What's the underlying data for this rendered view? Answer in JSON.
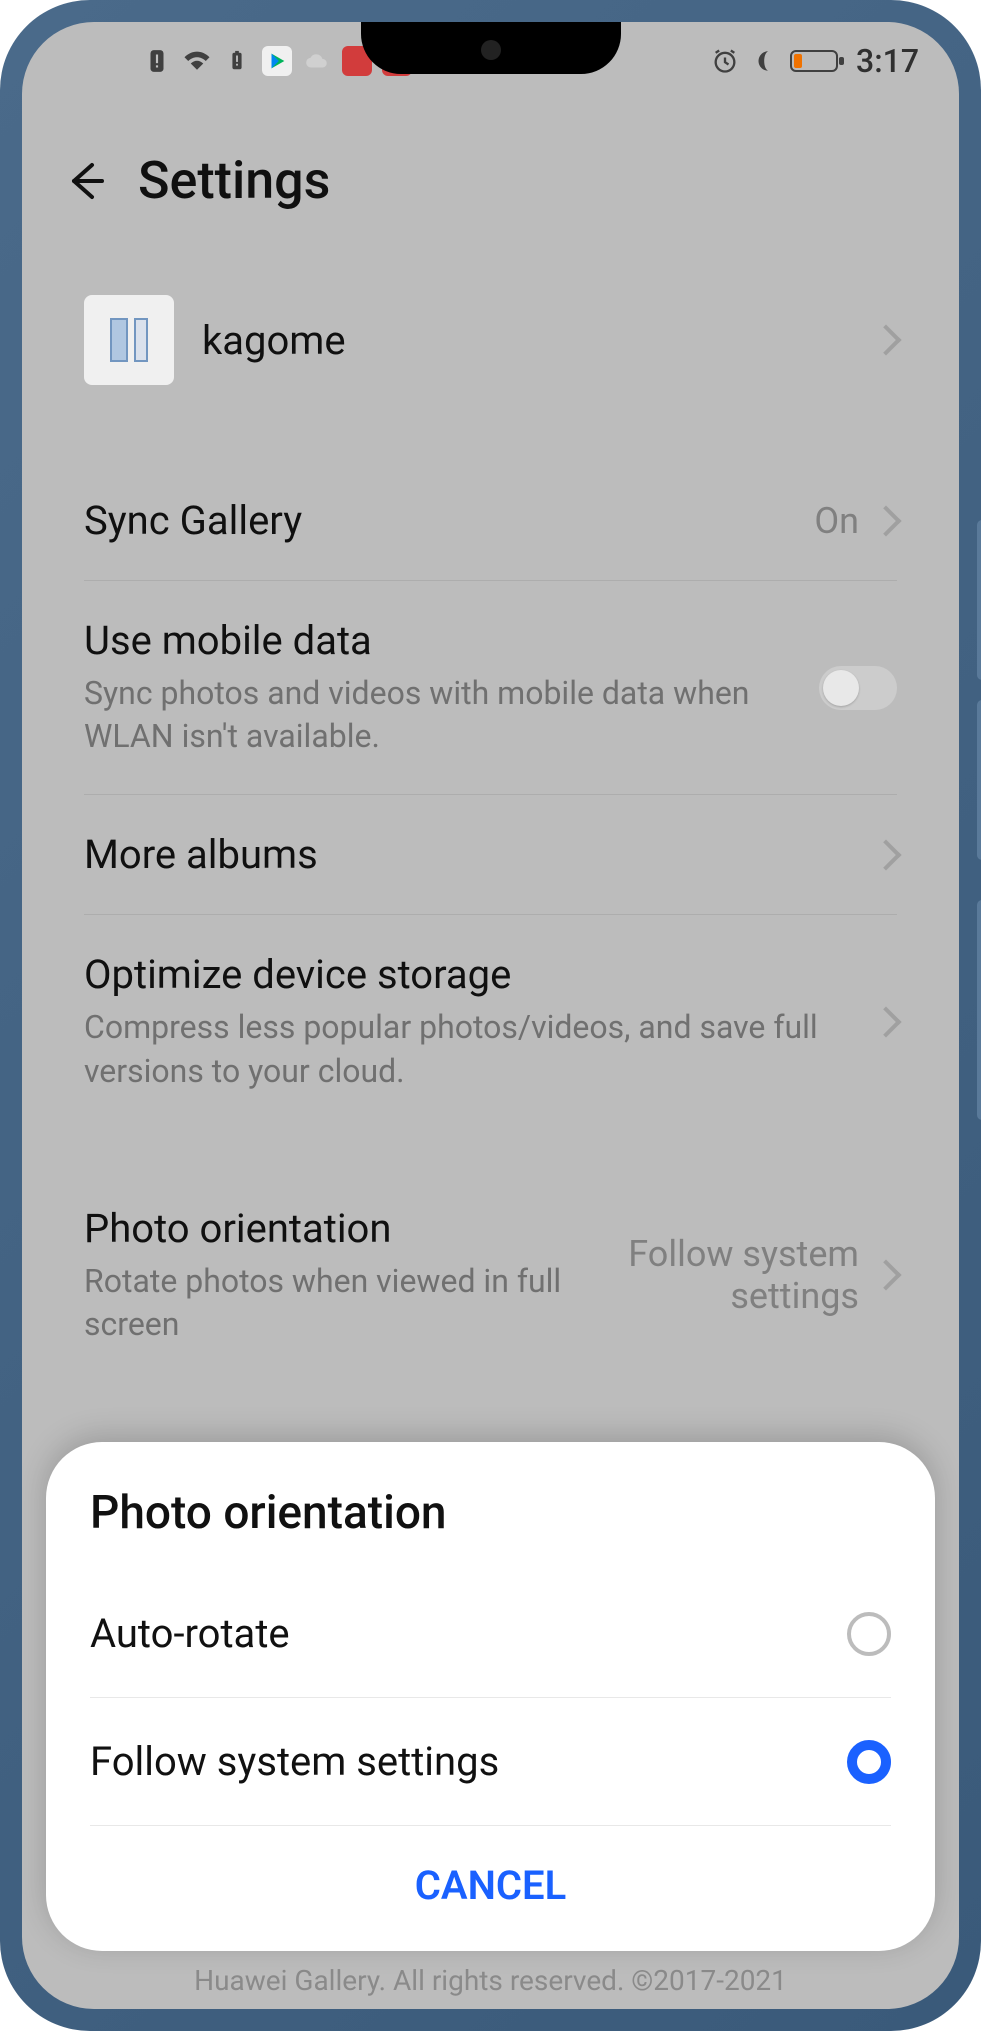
{
  "status": {
    "time": "3:17",
    "icons": {
      "warning": "!",
      "wifi": "wifi",
      "battery_warn": "!",
      "alarm": "alarm",
      "moon": "dnd",
      "battery_low": "low"
    }
  },
  "header": {
    "title": "Settings"
  },
  "profile": {
    "name": "kagome"
  },
  "group1": {
    "sync_gallery": {
      "title": "Sync Gallery",
      "value": "On"
    },
    "mobile_data": {
      "title": "Use mobile data",
      "sub": "Sync photos and videos with mobile data when WLAN isn't available.",
      "toggled": false
    },
    "more_albums": {
      "title": "More albums"
    },
    "optimize": {
      "title": "Optimize device storage",
      "sub": "Compress less popular photos/videos, and save full versions to your cloud."
    }
  },
  "group2": {
    "photo_orientation": {
      "title": "Photo orientation",
      "sub": "Rotate photos when viewed in full screen",
      "value": "Follow system settings"
    }
  },
  "sheet": {
    "title": "Photo orientation",
    "options": [
      {
        "label": "Auto-rotate",
        "selected": false
      },
      {
        "label": "Follow system settings",
        "selected": true
      }
    ],
    "cancel": "CANCEL"
  },
  "footer": "Huawei Gallery. All rights reserved. ©2017-2021",
  "colors": {
    "accent": "#1a61ff"
  }
}
